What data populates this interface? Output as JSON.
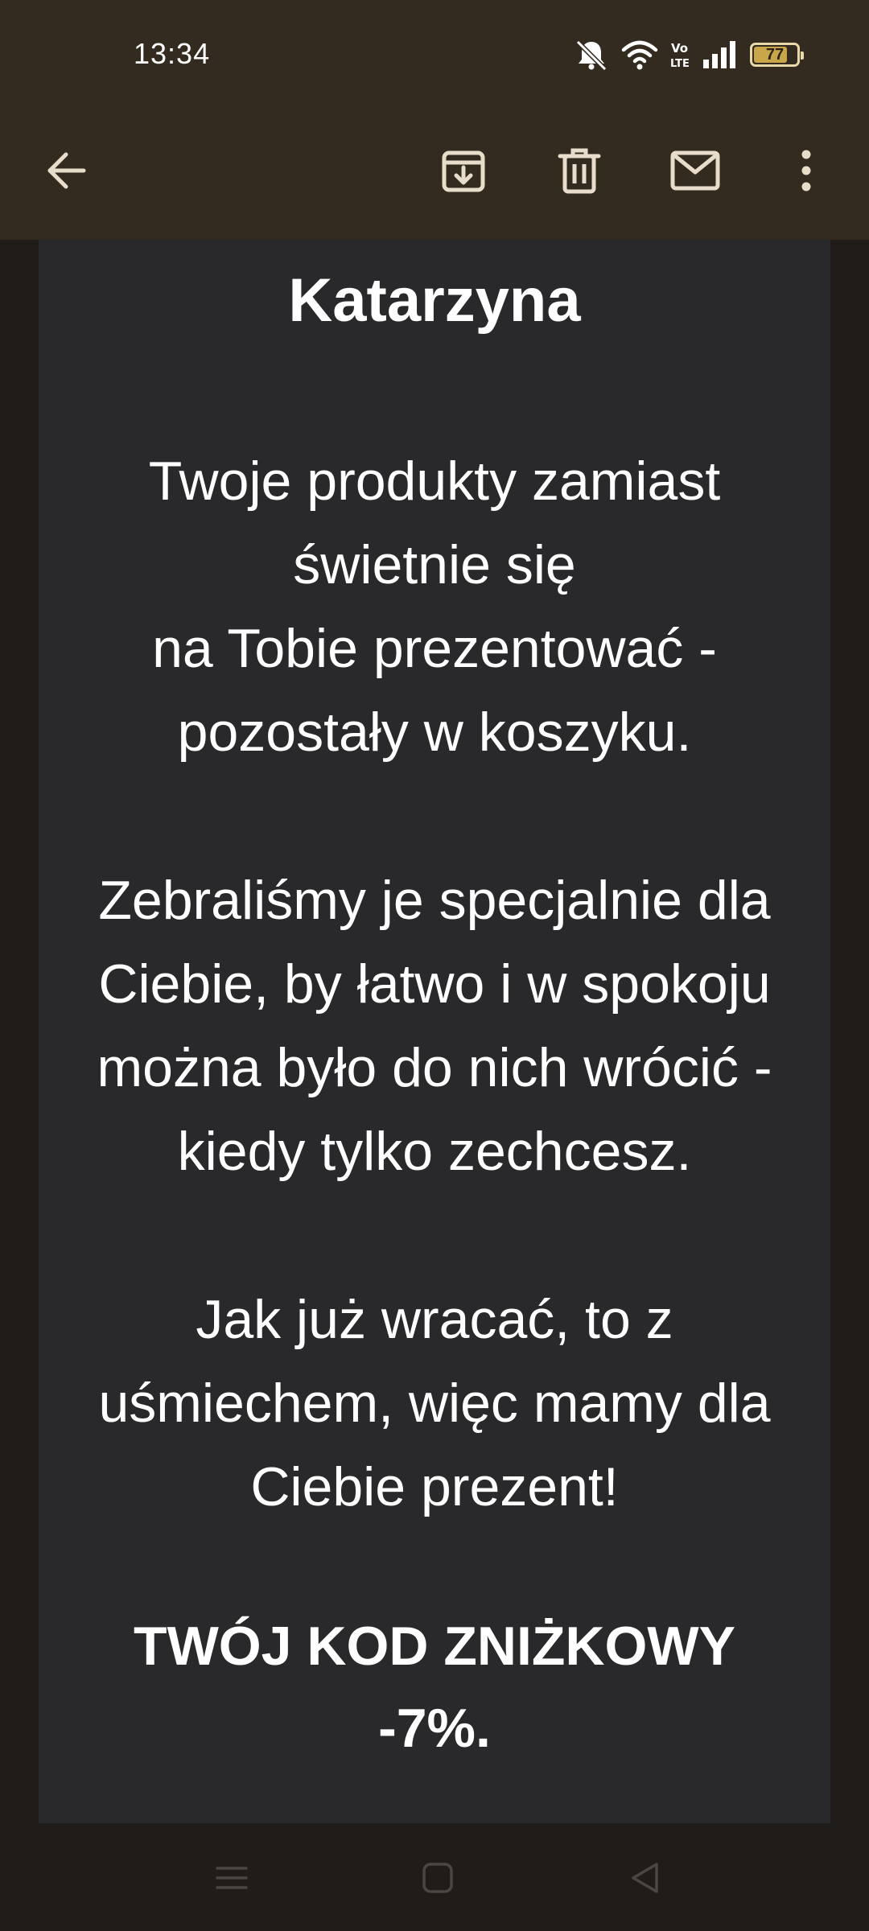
{
  "status_bar": {
    "time": "13:34",
    "battery_level": "77",
    "icons": [
      "bell-muted-icon",
      "wifi-icon",
      "volte-icon",
      "signal-icon",
      "battery-icon"
    ]
  },
  "toolbar": {
    "icons": [
      "back-arrow-icon",
      "archive-icon",
      "delete-icon",
      "mark-unread-icon",
      "more-options-icon"
    ]
  },
  "email": {
    "name": "Katarzyna",
    "paragraph1": [
      "Twoje produkty zamiast",
      "świetnie się",
      "na Tobie prezentować -",
      "pozostały w koszyku."
    ],
    "paragraph2": [
      "Zebraliśmy je specjalnie dla",
      "Ciebie, by łatwo i w spokoju",
      "można było do nich wrócić -",
      "kiedy tylko zechcesz."
    ],
    "paragraph3": [
      "Jak już wracać, to z",
      "uśmiechem, więc mamy dla",
      "Ciebie prezent!"
    ],
    "code_heading": [
      "TWÓJ KOD ZNIŻKOWY",
      "-7%."
    ]
  },
  "nav_bar": {
    "icons": [
      "menu-icon",
      "home-icon",
      "back-icon"
    ]
  },
  "colors": {
    "app_bar": "#342b20",
    "card_bg": "#29292b",
    "page_bg": "#1f1c19",
    "icon_light": "#e8dccb"
  }
}
